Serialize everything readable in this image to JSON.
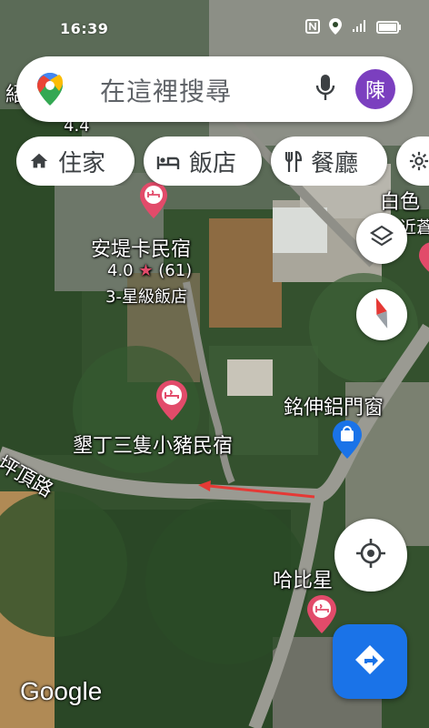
{
  "status_bar": {
    "time": "16:39"
  },
  "search": {
    "placeholder": "在這裡搜尋",
    "avatar_initial": "陳"
  },
  "chips": [
    {
      "label": "住家",
      "icon": "home-icon"
    },
    {
      "label": "飯店",
      "icon": "hotel-bed-icon"
    },
    {
      "label": "餐廳",
      "icon": "fork-knife-icon"
    },
    {
      "label": "",
      "icon": "gear-icon"
    }
  ],
  "map_labels": {
    "top_left_fragment": "紹",
    "partial_rating": "4.4",
    "partial_hotel": "3-星級飯店",
    "hotel_1_name": "安堤卡民宿",
    "hotel_1_rating": "4.0",
    "hotel_1_reviews": "(61)",
    "hotel_1_class": "3-星級飯店",
    "right_fragment_1": "白色",
    "right_fragment_2": "近蒼",
    "store_name": "銘伸鋁門窗",
    "hotel_2_name": "墾丁三隻小豬民宿",
    "road_name": "坪頂路",
    "bottom_right_fragment": "哈比星"
  },
  "brand": {
    "logo_text": "Google"
  },
  "colors": {
    "accent": "#1a73e8",
    "avatar": "#7b3fbf",
    "hotel_pin": "#e24b6a",
    "store_pin": "#1a73e8",
    "direction_arrow": "#e53935"
  },
  "buttons": {
    "layers": "layers-icon",
    "compass": "compass-icon",
    "my_location": "my-location-icon",
    "directions": "directions-icon"
  }
}
